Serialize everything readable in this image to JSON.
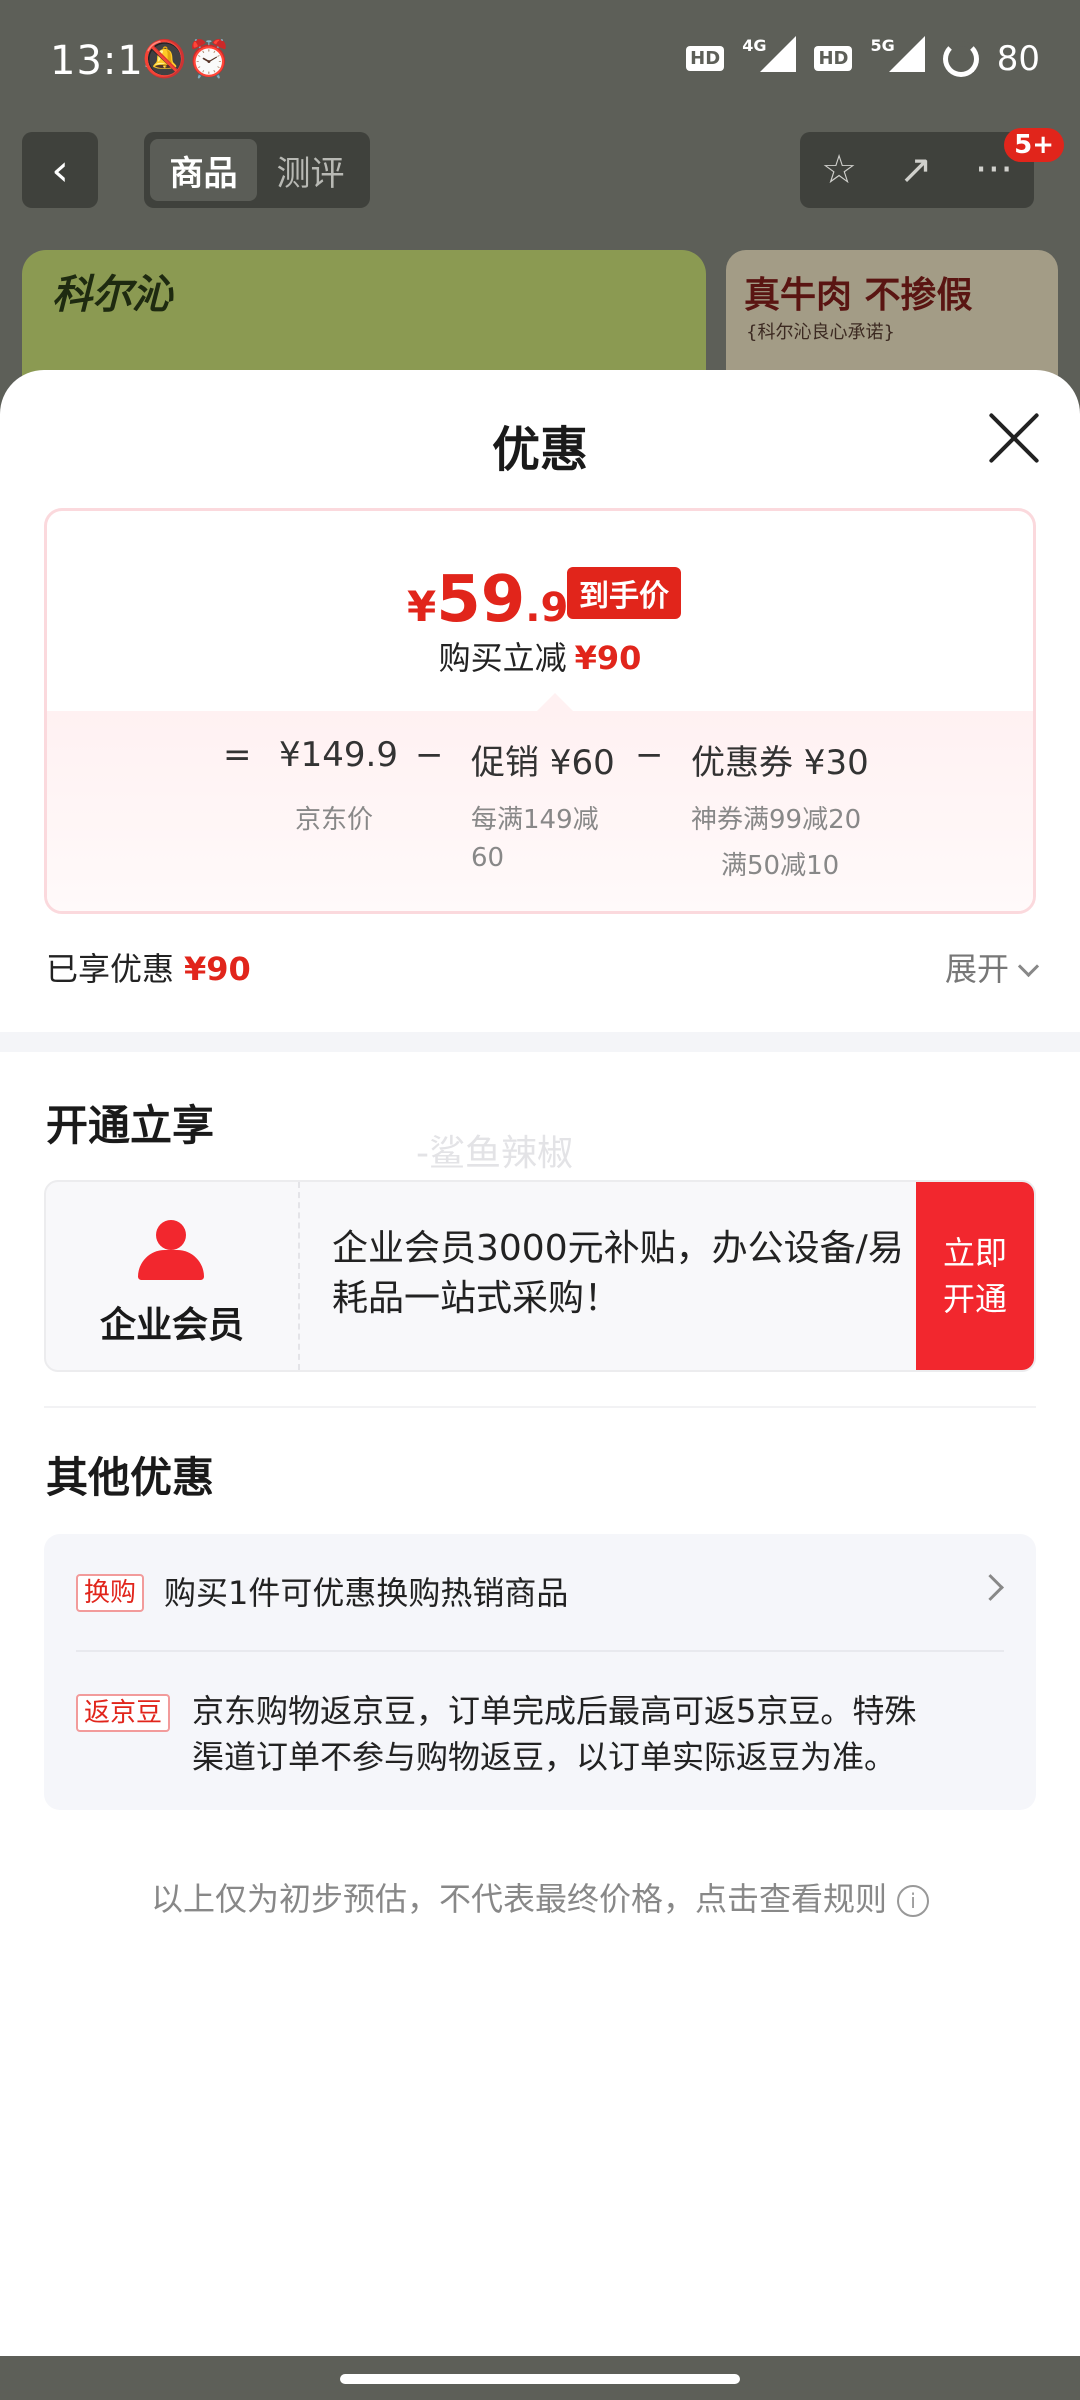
{
  "status_bar": {
    "time": "13:14",
    "left_icons": "🔕⏰",
    "net1": "4G",
    "net2": "5G",
    "hd": "HD",
    "battery": "80"
  },
  "nav": {
    "back": "‹",
    "tabs": [
      "商品",
      "测评"
    ],
    "actions": [
      "☆",
      "↗",
      "···"
    ],
    "badge": "5+"
  },
  "banners": {
    "brand": "科尔沁",
    "right_title": "真牛肉 不掺假",
    "right_sub": "{科尔沁良心承诺}"
  },
  "sheet": {
    "title": "优惠",
    "price": {
      "yen": "¥",
      "integer": "59",
      "decimal": ".9",
      "tag": "到手价",
      "reduce_label": "购买立减",
      "reduce_value": "¥90"
    },
    "breakdown": {
      "eq": "=",
      "jd_price": "¥149.9",
      "jd_price_label": "京东价",
      "minus1": "−",
      "promo": "促销 ¥60",
      "promo_line1": "每满149减",
      "promo_line2": "60",
      "minus2": "−",
      "coupon": "优惠券 ¥30",
      "coupon_line1": "神券满99减20",
      "coupon_line2": "满50减10"
    },
    "enjoyed_label": "已享优惠",
    "enjoyed_value": "¥90",
    "expand": "展开",
    "open_section_title": "开通立享",
    "watermark": "-鲨鱼辣椒",
    "member": {
      "name": "企业会员",
      "desc": "企业会员3000元补贴，办公设备/易耗品一站式采购！",
      "button_line1": "立即",
      "button_line2": "开通"
    },
    "other_title": "其他优惠",
    "other_items": [
      {
        "tag": "换购",
        "text": "购买1件可优惠换购热销商品"
      },
      {
        "tag": "返京豆",
        "text_line1": "京东购物返京豆，订单完成后最高可返5京豆。特殊",
        "text_line2": "渠道订单不参与购物返豆，以订单实际返豆为准。"
      }
    ],
    "footer": "以上仅为初步预估，不代表最终价格，点击查看规则",
    "footer_icon": "i"
  }
}
